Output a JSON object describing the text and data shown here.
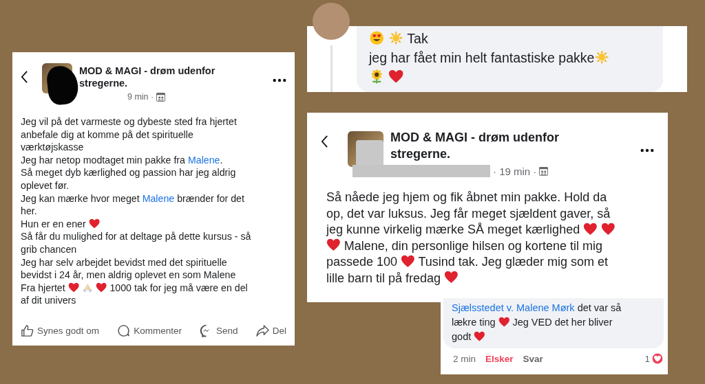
{
  "post_left": {
    "page_name": "MOD & MAGI - drøm udenfor stregerne.",
    "time": "9 min ·",
    "lines": [
      [
        {
          "kind": "text",
          "text": "Jeg vil på det varmeste og dybeste sted fra hjertet"
        }
      ],
      [
        {
          "kind": "text",
          "text": "anbefale dig at komme på det spirituelle"
        }
      ],
      [
        {
          "kind": "text",
          "text": "værktøjskasse"
        }
      ],
      [
        {
          "kind": "text",
          "text": "Jeg har netop modtaget min pakke fra"
        },
        {
          "kind": "link",
          "text": "Malene"
        },
        {
          "kind": "text",
          "text": ".",
          "attached": true
        }
      ],
      [
        {
          "kind": "text",
          "text": "Så meget dyb kærlighed og passion har jeg aldrig"
        }
      ],
      [
        {
          "kind": "text",
          "text": "oplevet før."
        }
      ],
      [
        {
          "kind": "text",
          "text": "Jeg kan mærke hvor meget"
        },
        {
          "kind": "link",
          "text": "Malene"
        },
        {
          "kind": "text",
          "text": "brænder for det"
        }
      ],
      [
        {
          "kind": "text",
          "text": "her."
        }
      ],
      [
        {
          "kind": "text",
          "text": "Hun er en ener"
        },
        {
          "kind": "heart"
        }
      ],
      [
        {
          "kind": "text",
          "text": "Så får du mulighed for at deltage på dette kursus - så"
        }
      ],
      [
        {
          "kind": "text",
          "text": "grib chancen"
        }
      ],
      [
        {
          "kind": "text",
          "text": "Jeg har selv arbejdet bevidst med det spirituelle"
        }
      ],
      [
        {
          "kind": "text",
          "text": "bevidst i 24 år, men aldrig oplevet en som Malene"
        }
      ],
      [
        {
          "kind": "text",
          "text": "Fra hjertet"
        },
        {
          "kind": "heart"
        },
        {
          "kind": "praying-hands"
        },
        {
          "kind": "heart"
        },
        {
          "kind": "text",
          "text": "1000 tak for jeg må være en del"
        }
      ],
      [
        {
          "kind": "text",
          "text": "af dit univers"
        }
      ]
    ],
    "actions": [
      {
        "kind": "like",
        "label": "Synes godt om"
      },
      {
        "kind": "comment",
        "label": "Kommenter"
      },
      {
        "kind": "send",
        "label": "Send"
      },
      {
        "kind": "share",
        "label": "Del"
      }
    ]
  },
  "reply_top": {
    "lines": [
      [
        {
          "kind": "heart-eyes"
        },
        {
          "kind": "sun"
        },
        {
          "kind": "text",
          "text": "Tak"
        }
      ],
      [
        {
          "kind": "text",
          "text": "jeg har fået min helt fantastiske pakke"
        },
        {
          "kind": "sun",
          "attached": true
        }
      ],
      [
        {
          "kind": "sunflower"
        },
        {
          "kind": "heart"
        }
      ]
    ]
  },
  "post_right": {
    "page_name": "MOD & MAGI - drøm udenfor stregerne.",
    "time": "· 19 min ·",
    "lines": [
      [
        {
          "kind": "text",
          "text": "Så nåede jeg hjem og fik åbnet min pakke. Hold da"
        }
      ],
      [
        {
          "kind": "text",
          "text": "op, det var luksus. Jeg får meget sjældent gaver, så"
        }
      ],
      [
        {
          "kind": "text",
          "text": "jeg kunne virkelig mærke SÅ meget kærlighed"
        },
        {
          "kind": "heart"
        },
        {
          "kind": "heart"
        }
      ],
      [
        {
          "kind": "heart"
        },
        {
          "kind": "text",
          "text": "Malene, din personlige hilsen og kortene til mig"
        }
      ],
      [
        {
          "kind": "text",
          "text": "passede 100"
        },
        {
          "kind": "heart"
        },
        {
          "kind": "text",
          "text": "Tusind tak. Jeg glæder mig som et"
        }
      ],
      [
        {
          "kind": "text",
          "text": "lille barn til på fredag"
        },
        {
          "kind": "heart"
        }
      ]
    ]
  },
  "comment": {
    "author": "Sjælsstedet v. Malene Mørk",
    "lines": [
      [
        {
          "kind": "text",
          "text": "det var så"
        }
      ],
      [
        {
          "kind": "text",
          "text": "lækre ting"
        },
        {
          "kind": "heart"
        },
        {
          "kind": "text",
          "text": "Jeg VED det her bliver"
        }
      ],
      [
        {
          "kind": "text",
          "text": "godt"
        },
        {
          "kind": "heart"
        }
      ]
    ],
    "time": "2 min",
    "love_label": "Elsker",
    "loved": true,
    "reply_label": "Svar",
    "reaction_count": "1"
  }
}
